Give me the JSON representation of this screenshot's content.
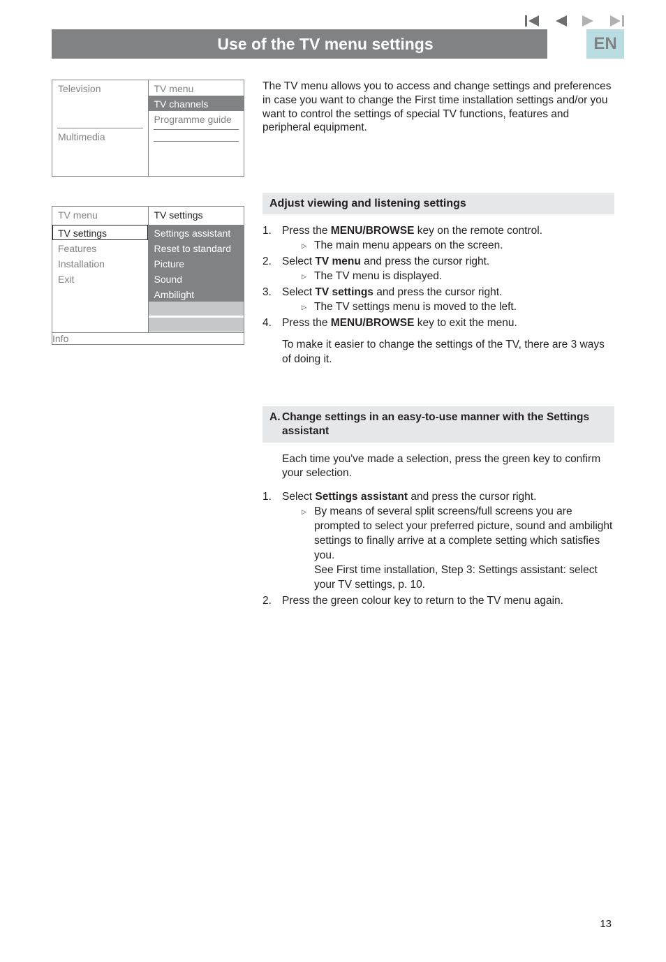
{
  "nav": {
    "colors": {
      "dark": "#6d6e70",
      "light": "#b0b1b3"
    }
  },
  "title": "Use of the TV menu settings",
  "lang": "EN",
  "intro": "The TV menu allows you to access and change settings and preferences in case you want to change the First time installation settings and/or you want to control the settings of special TV functions, features and peripheral equipment.",
  "menu1": {
    "leftItems": [
      "Television",
      "Multimedia"
    ],
    "rightItems": [
      "TV menu",
      "TV channels",
      "Programme guide"
    ]
  },
  "menu2": {
    "headerLeft": "TV menu",
    "headerRight": "TV settings",
    "leftItems": [
      "TV settings",
      "Features",
      "Installation",
      "Exit"
    ],
    "rightItems": [
      "Settings assistant",
      "Reset to standard",
      "Picture",
      "Sound",
      "Ambilight"
    ],
    "info": "Info"
  },
  "sectionAdjust": {
    "heading": "Adjust viewing and listening settings",
    "steps": [
      {
        "n": "1.",
        "pre": "Press the ",
        "bold": "MENU/BROWSE",
        "post": " key on the remote control.",
        "sub": "The main menu appears on the screen."
      },
      {
        "n": "2.",
        "pre": "Select ",
        "bold": "TV menu",
        "post": " and press the cursor right.",
        "sub": "The TV menu is displayed."
      },
      {
        "n": "3.",
        "pre": "Select ",
        "bold": "TV settings",
        "post": " and press the cursor right.",
        "sub": "The TV settings menu is moved to the left."
      },
      {
        "n": "4.",
        "pre": "Press the ",
        "bold": "MENU/BROWSE",
        "post": " key to exit the menu."
      }
    ],
    "trailer": "To make it easier to change the settings of the TV, there are 3 ways of doing it."
  },
  "sectionA": {
    "heading_lead": "A.",
    "heading_rest": "Change settings in an easy-to-use manner with the Settings assistant",
    "lead": "Each time you've made a selection, press the green key to confirm your selection.",
    "steps": [
      {
        "n": "1.",
        "pre": "Select ",
        "bold": "Settings assistant",
        "post": " and press the cursor right.",
        "sub": "By means of several split screens/full screens you are prompted to select your preferred picture, sound and ambilight settings to finally arrive at a complete setting which satisfies you.",
        "sub2": "See First time installation, Step 3: Settings assistant: select your TV settings, p. 10."
      },
      {
        "n": "2.",
        "text": "Press the green colour key to return to the TV menu again."
      }
    ]
  },
  "pageNumber": "13"
}
